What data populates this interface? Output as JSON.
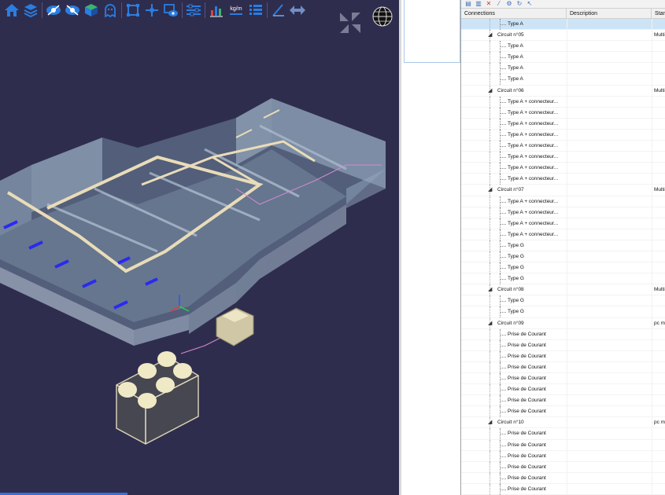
{
  "toolbar": {
    "icons": [
      "home-icon",
      "layers-icon",
      "eye-icon",
      "eye-off-icon",
      "cube-icon",
      "ghost-icon",
      "frame-icon",
      "move-icon",
      "screen-view-icon",
      "sliders-icon",
      "chart-icon",
      "unit-icon",
      "list-icon",
      "measure-icon",
      "arrows-icon"
    ],
    "unit_label": "kg/m"
  },
  "colors": {
    "viewport_bg": "#2f2d4d",
    "toolbar_icon": "#2a7de1",
    "selection": "#cde4f7"
  },
  "tree": {
    "toolbar_icons": [
      "doc-icon",
      "copy-icon",
      "delete-icon",
      "wand-icon",
      "gear-icon",
      "refresh-icon",
      "pointer-icon"
    ],
    "columns": [
      "Connections",
      "Description",
      "Stand"
    ],
    "rows": [
      {
        "kind": "child",
        "label": "Type A",
        "std": "",
        "selected": true
      },
      {
        "kind": "group",
        "label": "Circuit n°05",
        "std": "Multi"
      },
      {
        "kind": "child",
        "label": "Type A",
        "std": ""
      },
      {
        "kind": "child",
        "label": "Type A",
        "std": ""
      },
      {
        "kind": "child",
        "label": "Type A",
        "std": ""
      },
      {
        "kind": "child",
        "label": "Type A",
        "std": ""
      },
      {
        "kind": "group",
        "label": "Circuit n°06",
        "std": "Multi"
      },
      {
        "kind": "child",
        "label": "Type A + connecteur...",
        "std": ""
      },
      {
        "kind": "child",
        "label": "Type A + connecteur...",
        "std": ""
      },
      {
        "kind": "child",
        "label": "Type A + connecteur...",
        "std": ""
      },
      {
        "kind": "child",
        "label": "Type A + connecteur...",
        "std": ""
      },
      {
        "kind": "child",
        "label": "Type A + connecteur...",
        "std": ""
      },
      {
        "kind": "child",
        "label": "Type A + connecteur...",
        "std": ""
      },
      {
        "kind": "child",
        "label": "Type A + connecteur...",
        "std": ""
      },
      {
        "kind": "child",
        "label": "Type A + connecteur...",
        "std": ""
      },
      {
        "kind": "group",
        "label": "Circuit n°07",
        "std": "Multi"
      },
      {
        "kind": "child",
        "label": "Type A + connecteur...",
        "std": ""
      },
      {
        "kind": "child",
        "label": "Type A + connecteur...",
        "std": ""
      },
      {
        "kind": "child",
        "label": "Type A + connecteur...",
        "std": ""
      },
      {
        "kind": "child",
        "label": "Type A + connecteur...",
        "std": ""
      },
      {
        "kind": "child",
        "label": "Type G",
        "std": ""
      },
      {
        "kind": "child",
        "label": "Type G",
        "std": ""
      },
      {
        "kind": "child",
        "label": "Type G",
        "std": ""
      },
      {
        "kind": "child",
        "label": "Type G",
        "std": ""
      },
      {
        "kind": "group",
        "label": "Circuit n°08",
        "std": "Multi"
      },
      {
        "kind": "child",
        "label": "Type G",
        "std": ""
      },
      {
        "kind": "child",
        "label": "Type G",
        "std": ""
      },
      {
        "kind": "group",
        "label": "Circuit n°09",
        "std": "pc mu"
      },
      {
        "kind": "child",
        "label": "Prise de Courant",
        "std": ""
      },
      {
        "kind": "child",
        "label": "Prise de Courant",
        "std": ""
      },
      {
        "kind": "child",
        "label": "Prise de Courant",
        "std": ""
      },
      {
        "kind": "child",
        "label": "Prise de Courant",
        "std": ""
      },
      {
        "kind": "child",
        "label": "Prise de Courant",
        "std": ""
      },
      {
        "kind": "child",
        "label": "Prise de Courant",
        "std": ""
      },
      {
        "kind": "child",
        "label": "Prise de Courant",
        "std": ""
      },
      {
        "kind": "child",
        "label": "Prise de Courant",
        "std": ""
      },
      {
        "kind": "group",
        "label": "Circuit n°10",
        "std": "pc mu"
      },
      {
        "kind": "child",
        "label": "Prise de Courant",
        "std": ""
      },
      {
        "kind": "child",
        "label": "Prise de Courant",
        "std": ""
      },
      {
        "kind": "child",
        "label": "Prise de Courant",
        "std": ""
      },
      {
        "kind": "child",
        "label": "Prise de Courant",
        "std": ""
      },
      {
        "kind": "child",
        "label": "Prise de Courant",
        "std": ""
      },
      {
        "kind": "child",
        "label": "Prise de Courant",
        "std": ""
      }
    ]
  }
}
